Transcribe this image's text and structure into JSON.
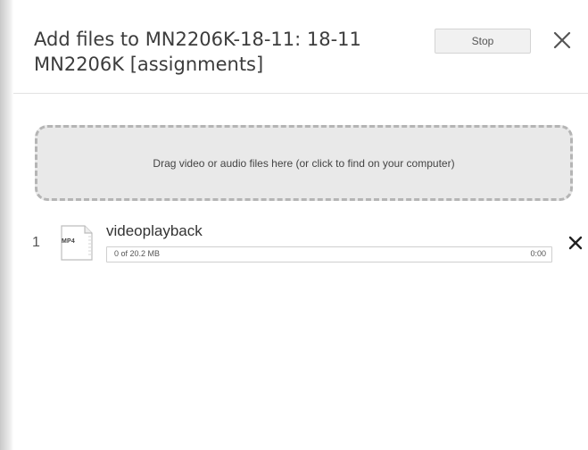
{
  "dialog": {
    "title": "Add files to MN2206K-18-11: 18-11 MN2206K [assignments]",
    "stop_label": "Stop",
    "close_icon": "close-icon"
  },
  "dropzone": {
    "text": "Drag video or audio files here (or click to find on your computer)"
  },
  "files": [
    {
      "index": "1",
      "type_badge": "MP4",
      "name": "videoplayback",
      "size_text": "0 of 20.2 MB",
      "time_text": "0:00",
      "progress_fraction": 0,
      "remove_icon": "close-icon"
    }
  ],
  "colors": {
    "dropzone_bg": "#e9e9e9",
    "dropzone_border": "#b5b5b5"
  }
}
